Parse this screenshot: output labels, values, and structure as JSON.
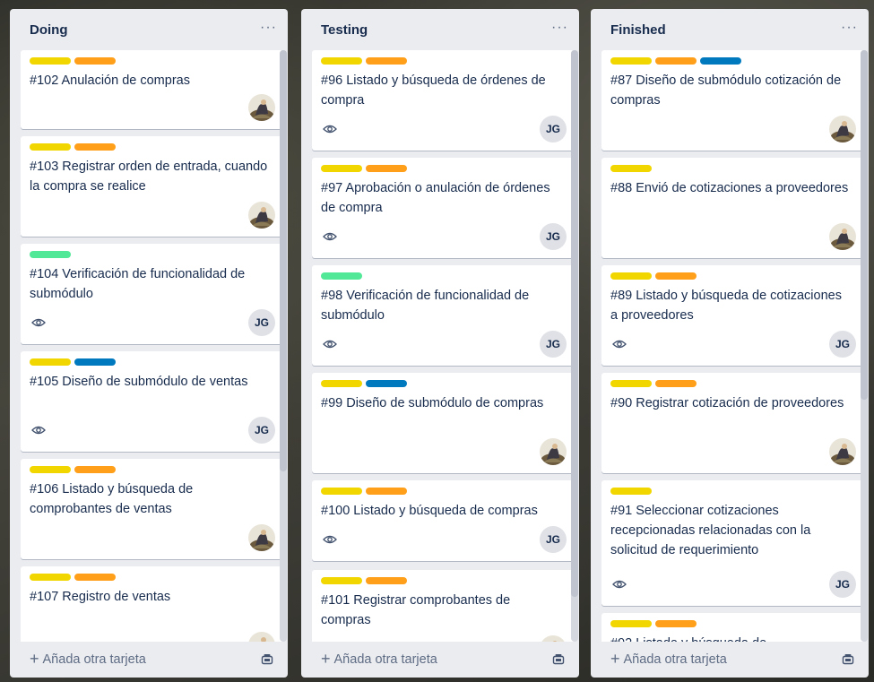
{
  "colors": {
    "yellow": "#f2d600",
    "orange": "#ff9f1a",
    "blue": "#0079bf",
    "green": "#51e898"
  },
  "common": {
    "add_card_label": "Añada otra tarjeta",
    "menu_label": "···",
    "initials": "JG"
  },
  "lists": [
    {
      "title": "Doing",
      "cards": [
        {
          "labels": [
            "yellow",
            "orange"
          ],
          "title": "#102 Anulación de compras",
          "watch": false,
          "member": "photo"
        },
        {
          "labels": [
            "yellow",
            "orange"
          ],
          "title": "#103 Registrar orden de entrada, cuando la compra se realice",
          "watch": false,
          "member": "photo"
        },
        {
          "labels": [
            "green"
          ],
          "title": "#104 Verificación de funcionalidad de submódulo",
          "watch": true,
          "member": "JG"
        },
        {
          "labels": [
            "yellow",
            "blue"
          ],
          "title": "#105 Diseño de submódulo de ventas",
          "watch": true,
          "member": "JG"
        },
        {
          "labels": [
            "yellow",
            "orange"
          ],
          "title": "#106 Listado y búsqueda de comprobantes de ventas",
          "watch": false,
          "member": "photo"
        },
        {
          "labels": [
            "yellow",
            "orange"
          ],
          "title": "#107 Registro de ventas",
          "watch": false,
          "member": "photo"
        }
      ]
    },
    {
      "title": "Testing",
      "cards": [
        {
          "labels": [
            "yellow",
            "orange"
          ],
          "title": "#96 Listado y búsqueda de órdenes de compra",
          "watch": true,
          "member": "JG"
        },
        {
          "labels": [
            "yellow",
            "orange"
          ],
          "title": "#97 Aprobación o anulación de órdenes de compra",
          "watch": true,
          "member": "JG"
        },
        {
          "labels": [
            "green"
          ],
          "title": "#98 Verificación de funcionalidad de submódulo",
          "watch": true,
          "member": "JG"
        },
        {
          "labels": [
            "yellow",
            "blue"
          ],
          "title": "#99 Diseño de submódulo de compras",
          "watch": false,
          "member": "photo"
        },
        {
          "labels": [
            "yellow",
            "orange"
          ],
          "title": "#100 Listado y búsqueda de compras",
          "watch": true,
          "member": "JG"
        },
        {
          "labels": [
            "yellow",
            "orange"
          ],
          "title": "#101 Registrar comprobantes de compras",
          "watch": false,
          "member": "photo"
        }
      ]
    },
    {
      "title": "Finished",
      "cards": [
        {
          "labels": [
            "yellow",
            "orange",
            "blue"
          ],
          "title": "#87 Diseño de submódulo cotización de compras",
          "watch": false,
          "member": "photo"
        },
        {
          "labels": [
            "yellow"
          ],
          "title": "#88 Envió de cotizaciones a proveedores",
          "watch": false,
          "member": "photo"
        },
        {
          "labels": [
            "yellow",
            "orange"
          ],
          "title": "#89 Listado y búsqueda de cotizaciones a proveedores",
          "watch": true,
          "member": "JG"
        },
        {
          "labels": [
            "yellow",
            "orange"
          ],
          "title": "#90 Registrar cotización de proveedores",
          "watch": false,
          "member": "photo"
        },
        {
          "labels": [
            "yellow"
          ],
          "title": "#91 Seleccionar cotizaciones recepcionadas relacionadas con la solicitud de requerimiento",
          "watch": true,
          "member": "JG"
        },
        {
          "labels": [
            "yellow",
            "orange"
          ],
          "title": "#92 Listado y búsqueda de",
          "watch": false,
          "member": "none"
        }
      ]
    }
  ]
}
